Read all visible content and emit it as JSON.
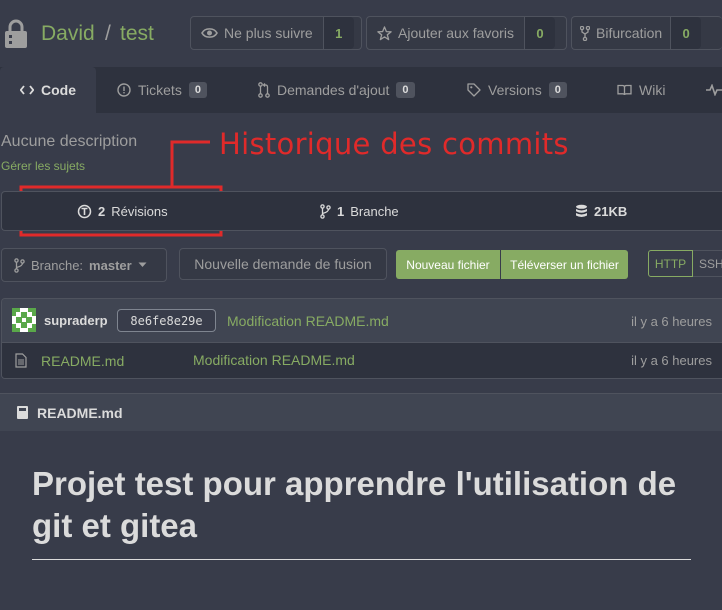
{
  "repo": {
    "owner": "David",
    "separator": "/",
    "name": "test",
    "watch": {
      "label": "Ne plus suivre",
      "count": "1"
    },
    "star": {
      "label": "Ajouter aux favoris",
      "count": "0"
    },
    "fork": {
      "label": "Bifurcation",
      "count": "0"
    }
  },
  "tabs": [
    {
      "label": "Code",
      "icon": "code-icon",
      "active": true
    },
    {
      "label": "Tickets",
      "count": "0",
      "icon": "issue-icon"
    },
    {
      "label": "Demandes d'ajout",
      "count": "0",
      "icon": "pull-request-icon"
    },
    {
      "label": "Versions",
      "count": "0",
      "icon": "tag-icon"
    },
    {
      "label": "Wiki",
      "icon": "book-icon"
    }
  ],
  "description": "Aucune description",
  "topics_link": "Gérer les sujets",
  "annotation": "Historique des commits",
  "stats": {
    "commits_count": "2",
    "commits_label": "Révisions",
    "branches_count": "1",
    "branches_label": "Branche",
    "size": "21KB"
  },
  "branch": {
    "label": "Branche:",
    "name": "master"
  },
  "buttons": {
    "new_pr": "Nouvelle demande de fusion",
    "new_file": "Nouveau fichier",
    "upload": "Téléverser un fichier",
    "http": "HTTP",
    "ssh": "SSH"
  },
  "latest_commit": {
    "author": "supraderp",
    "sha": "8e6fe8e29e",
    "message": "Modification README.md",
    "time": "il y a 6 heures"
  },
  "files": [
    {
      "name": "README.md",
      "message": "Modification README.md",
      "time": "il y a 6 heures"
    }
  ],
  "readme": {
    "title": "README.md",
    "heading": "Projet test pour apprendre l'utilisation de git et gitea"
  },
  "colors": {
    "accent": "#87ab63",
    "annotation": "#e02a2a",
    "background": "#383c4a"
  }
}
